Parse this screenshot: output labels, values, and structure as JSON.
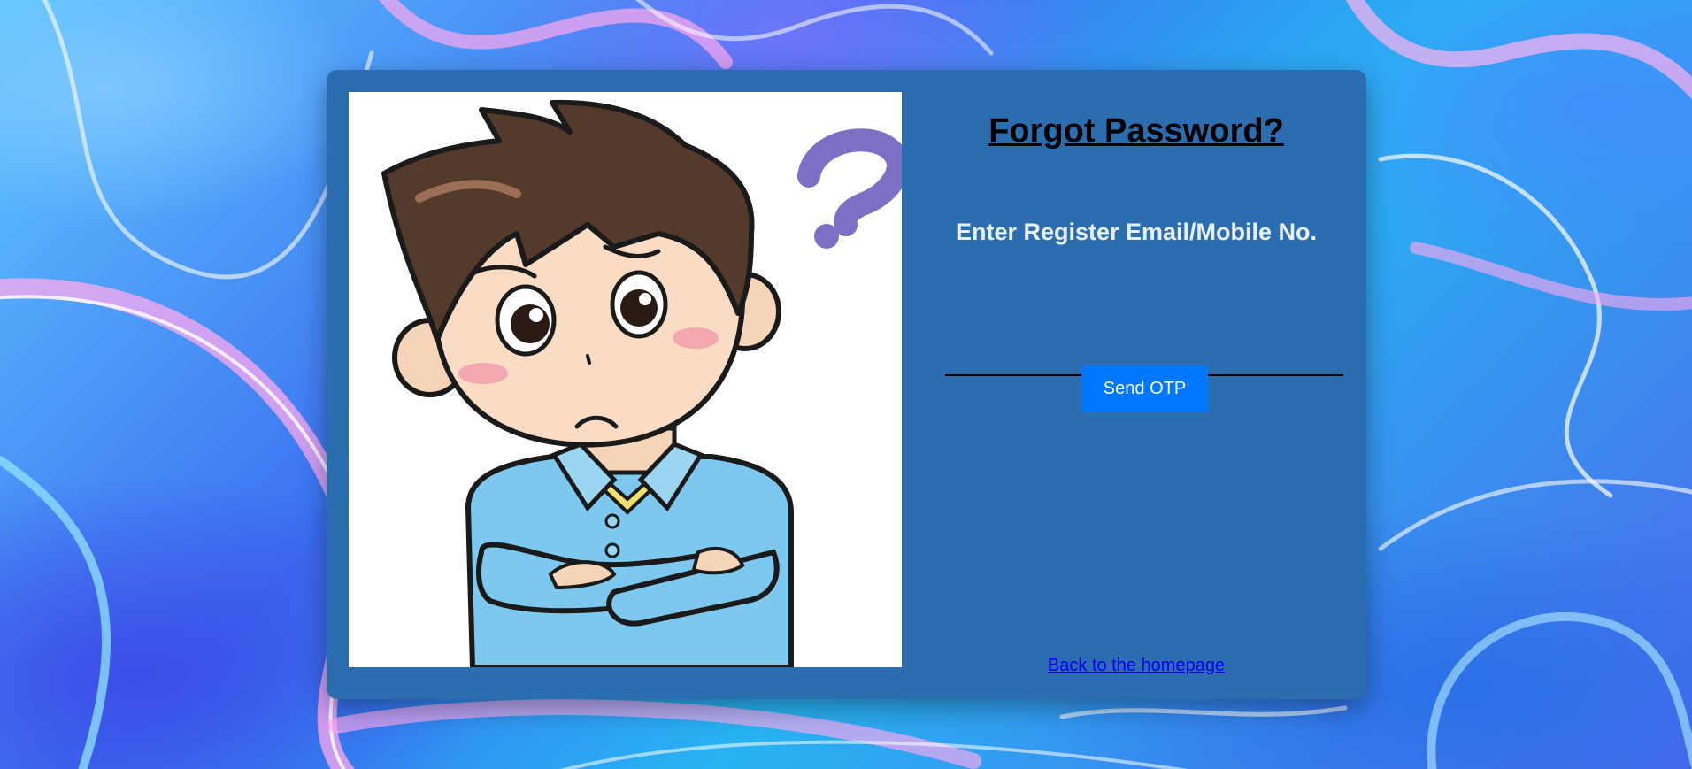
{
  "page": {
    "title": "Forgot Password?",
    "field_label": "Enter Register Email/Mobile No.",
    "email_input": {
      "value": "",
      "placeholder": ""
    },
    "send_otp_label": "Send OTP",
    "back_link": "Back to the homepage"
  },
  "illustration": {
    "icon": "confused-boy-question-mark-illustration"
  },
  "colors": {
    "card": "#2c6db0",
    "button": "#0077ff",
    "title": "#000000",
    "label": "#eaf0f8",
    "link": "#0000ee"
  }
}
